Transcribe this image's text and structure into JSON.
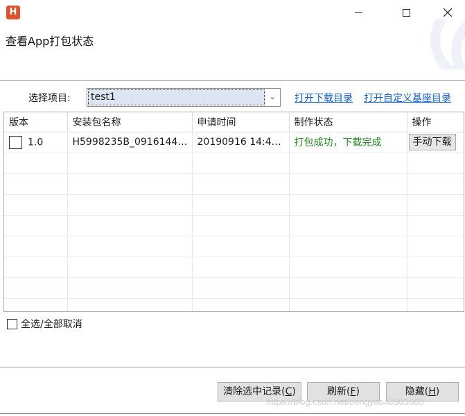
{
  "window": {
    "app_icon_letter": "H",
    "title": "查看App打包状态"
  },
  "project": {
    "label": "选择项目:",
    "selected": "test1"
  },
  "links": {
    "open_download_dir": "打开下载目录",
    "open_custom_base_dir": "打开自定义基座目录"
  },
  "table": {
    "columns": [
      "版本",
      "安装包名称",
      "申请时间",
      "制作状态",
      "操作"
    ],
    "rows": [
      {
        "version": "1.0",
        "package_name": "H5998235B_0916144…",
        "request_time": "20190916 14:4…",
        "status": "打包成功，下载完成",
        "action": "手动下载",
        "checked": false
      }
    ]
  },
  "select_all_label": "全选/全部取消",
  "buttons": {
    "clear_selected": "清除选中记录",
    "clear_selected_key": "C",
    "refresh": "刷新",
    "refresh_key": "F",
    "hide": "隐藏",
    "hide_key": "H"
  },
  "watermark": "https://blog.csdn.net/dengyao40305665",
  "colors": {
    "link": "#0b5cd5",
    "status_success": "#1e8a1e",
    "app_icon": "#e0522e"
  }
}
